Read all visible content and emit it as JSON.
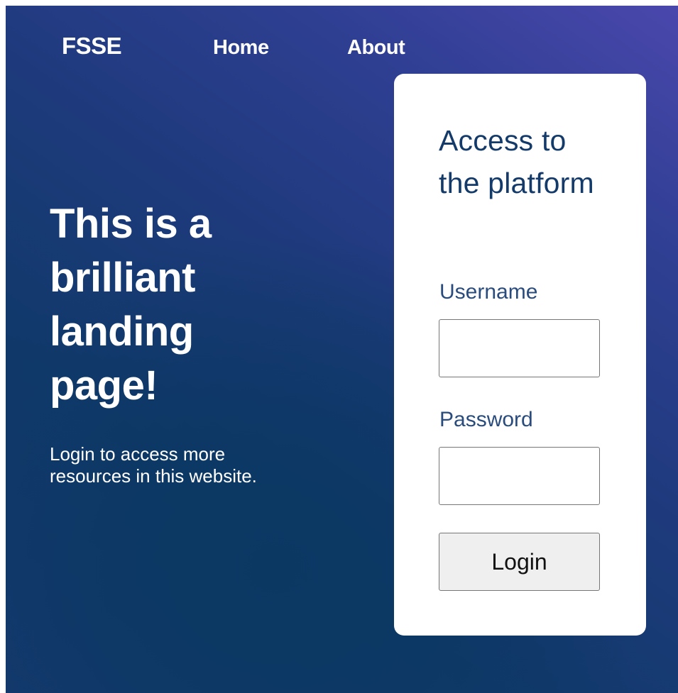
{
  "nav": {
    "brand": "FSSE",
    "links": [
      {
        "label": "Home"
      },
      {
        "label": "About"
      }
    ]
  },
  "hero": {
    "title": "This is a brilliant landing page!",
    "text": "Login to access more resources in this website."
  },
  "login": {
    "title": "Access to the platform",
    "username_label": "Username",
    "username_value": "",
    "password_label": "Password",
    "password_value": "",
    "button_label": "Login"
  },
  "colors": {
    "background_dark": "#0b3863",
    "background_accent": "#4a47ac",
    "card": "#ffffff",
    "heading": "#143a6a",
    "label": "#2a4c7d",
    "button": "#efefef"
  }
}
